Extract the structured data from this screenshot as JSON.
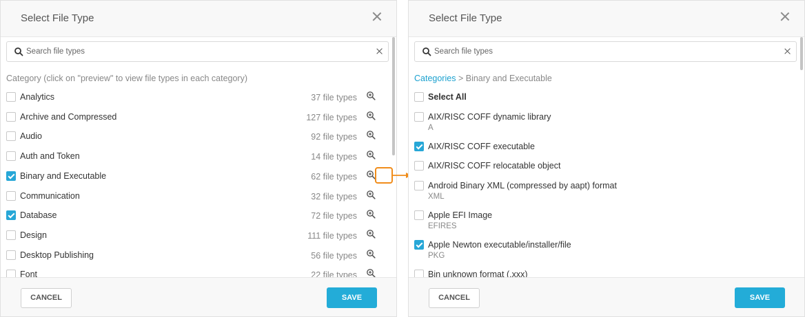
{
  "left": {
    "title": "Select File Type",
    "search_placeholder": "Search file types",
    "category_header": "Category (click on \"preview\" to view file types in each category)",
    "categories": [
      {
        "label": "Analytics",
        "count": "37 file types",
        "checked": false
      },
      {
        "label": "Archive and Compressed",
        "count": "127 file types",
        "checked": false
      },
      {
        "label": "Audio",
        "count": "92 file types",
        "checked": false
      },
      {
        "label": "Auth and Token",
        "count": "14 file types",
        "checked": false
      },
      {
        "label": "Binary and Executable",
        "count": "62 file types",
        "checked": true
      },
      {
        "label": "Communication",
        "count": "32 file types",
        "checked": false
      },
      {
        "label": "Database",
        "count": "72 file types",
        "checked": true
      },
      {
        "label": "Design",
        "count": "111 file types",
        "checked": false
      },
      {
        "label": "Desktop Publishing",
        "count": "56 file types",
        "checked": false
      },
      {
        "label": "Font",
        "count": "22 file types",
        "checked": false
      }
    ],
    "cancel_label": "CANCEL",
    "save_label": "SAVE"
  },
  "right": {
    "title": "Select File Type",
    "search_placeholder": "Search file types",
    "breadcrumb_root": "Categories",
    "breadcrumb_sep": ">",
    "breadcrumb_current": "Binary and Executable",
    "select_all": "Select All",
    "file_types": [
      {
        "label": "AIX/RISC COFF dynamic library",
        "ext": "A",
        "checked": false
      },
      {
        "label": "AIX/RISC COFF executable",
        "ext": "",
        "checked": true
      },
      {
        "label": "AIX/RISC COFF relocatable object",
        "ext": "",
        "checked": false
      },
      {
        "label": "Android Binary XML (compressed by aapt) format",
        "ext": "XML",
        "checked": false
      },
      {
        "label": "Apple EFI Image",
        "ext": "EFIRES",
        "checked": false
      },
      {
        "label": "Apple Newton executable/installer/file",
        "ext": "PKG",
        "checked": true
      },
      {
        "label": "Bin unknown format (.xxx)",
        "ext": "",
        "checked": false
      }
    ],
    "cancel_label": "CANCEL",
    "save_label": "SAVE"
  },
  "colors": {
    "accent": "#23acd8",
    "highlight": "#f08c1a"
  }
}
